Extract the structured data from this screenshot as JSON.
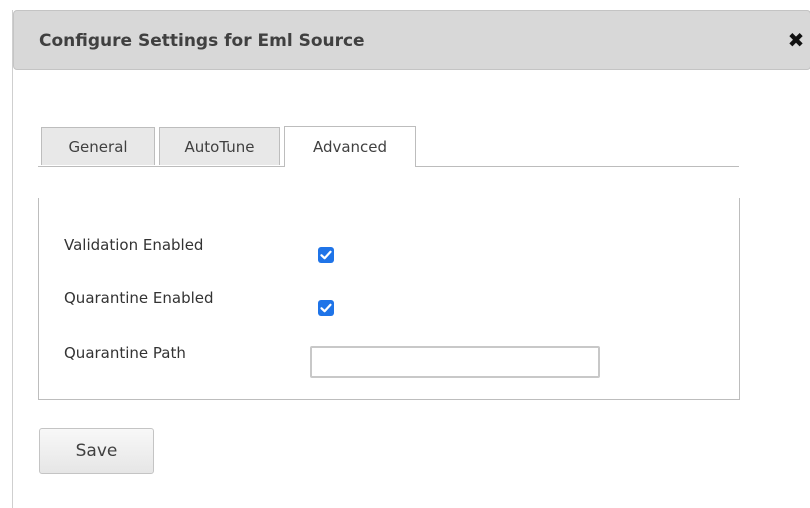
{
  "dialog": {
    "title": "Configure Settings for Eml Source",
    "close_glyph": "✖",
    "close_icon": "close-icon"
  },
  "tabs": [
    {
      "label": "General",
      "active": false
    },
    {
      "label": "AutoTune",
      "active": false
    },
    {
      "label": "Advanced",
      "active": true
    }
  ],
  "advanced": {
    "validation_label": "Validation Enabled",
    "validation_checked": true,
    "quarantine_label": "Quarantine Enabled",
    "quarantine_checked": true,
    "path_label": "Quarantine Path",
    "path_value": ""
  },
  "footer": {
    "save_label": "Save"
  },
  "colors": {
    "checkbox_accent": "#1f74e8",
    "titlebar_bg": "#d8d8d8"
  }
}
